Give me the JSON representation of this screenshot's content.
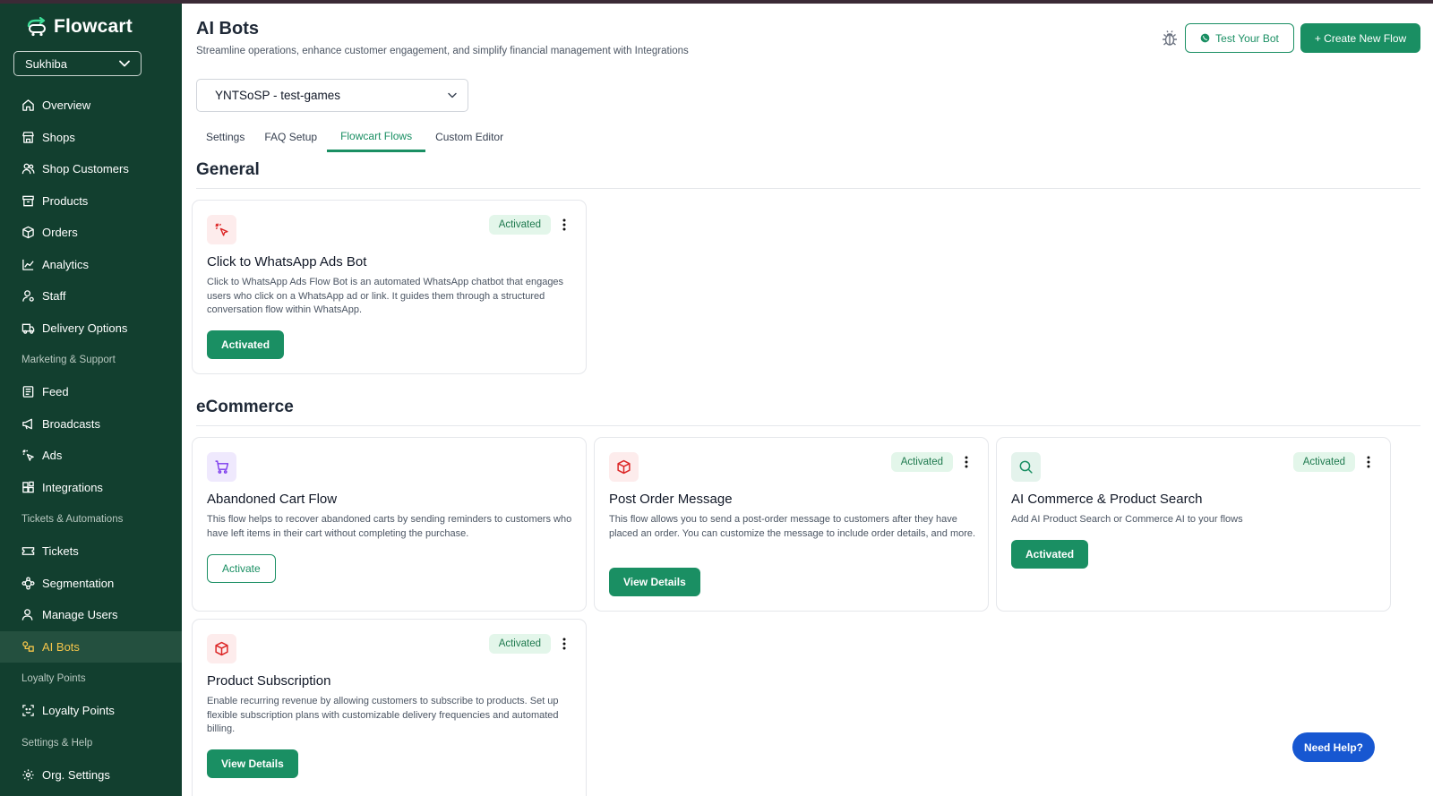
{
  "brand": {
    "name": "Flowcart"
  },
  "org_selector": {
    "value": "Sukhiba"
  },
  "sidebar": {
    "items": [
      {
        "label": "Overview"
      },
      {
        "label": "Shops"
      },
      {
        "label": "Shop Customers"
      },
      {
        "label": "Products"
      },
      {
        "label": "Orders"
      },
      {
        "label": "Analytics"
      },
      {
        "label": "Staff"
      },
      {
        "label": "Delivery Options"
      },
      {
        "section": "Marketing & Support"
      },
      {
        "label": "Feed"
      },
      {
        "label": "Broadcasts"
      },
      {
        "label": "Ads"
      },
      {
        "label": "Integrations"
      },
      {
        "section": "Tickets & Automations"
      },
      {
        "label": "Tickets"
      },
      {
        "label": "Segmentation"
      },
      {
        "label": "Manage Users"
      },
      {
        "label": "AI Bots",
        "active": true
      },
      {
        "section": "Loyalty Points"
      },
      {
        "label": "Loyalty Points"
      },
      {
        "section": "Settings & Help"
      },
      {
        "label": "Org. Settings"
      }
    ]
  },
  "header": {
    "title": "AI Bots",
    "subtitle": "Streamline operations, enhance customer engagement, and simplify financial management with Integrations",
    "test_bot_label": "Test Your Bot",
    "create_flow_label": "+ Create New Flow"
  },
  "bot_selector": {
    "value": "YNTSoSP - test-games"
  },
  "tabs": [
    {
      "label": "Settings"
    },
    {
      "label": "FAQ Setup"
    },
    {
      "label": "Flowcart Flows",
      "active": true
    },
    {
      "label": "Custom Editor"
    }
  ],
  "sections": {
    "general": {
      "title": "General",
      "cards": [
        {
          "title": "Click to WhatsApp Ads Bot",
          "badge": "Activated",
          "description": "Click to WhatsApp Ads Flow Bot is an automated WhatsApp chatbot that engages users who click on a WhatsApp ad or link. It guides them through a structured conversation flow within WhatsApp.",
          "button": "Activated"
        }
      ]
    },
    "ecommerce": {
      "title": "eCommerce",
      "cards": [
        {
          "title": "Abandoned Cart Flow",
          "description": "This flow helps to recover abandoned carts by sending reminders to customers who have left items in their cart without completing the purchase.",
          "button": "Activate"
        },
        {
          "title": "Post Order Message",
          "badge": "Activated",
          "description": "This flow allows you to send a post-order message to customers after they have placed an order. You can customize the message to include order details, and more.",
          "button": "View Details"
        },
        {
          "title": "AI Commerce & Product Search",
          "badge": "Activated",
          "description": "Add AI Product Search or Commerce AI to your flows",
          "button": "Activated"
        },
        {
          "title": "Product Subscription",
          "badge": "Activated",
          "description": "Enable recurring revenue by allowing customers to subscribe to products. Set up flexible subscription plans with customizable delivery frequencies and automated billing.",
          "button": "View Details"
        }
      ]
    }
  },
  "help": {
    "label": "Need Help?"
  },
  "colors": {
    "sidebar_bg": "#123f2f",
    "accent": "#1a8f63",
    "active_nav_text": "#f4c54a",
    "badge_bg": "#e3f6ea",
    "help_button": "#1757d1"
  }
}
